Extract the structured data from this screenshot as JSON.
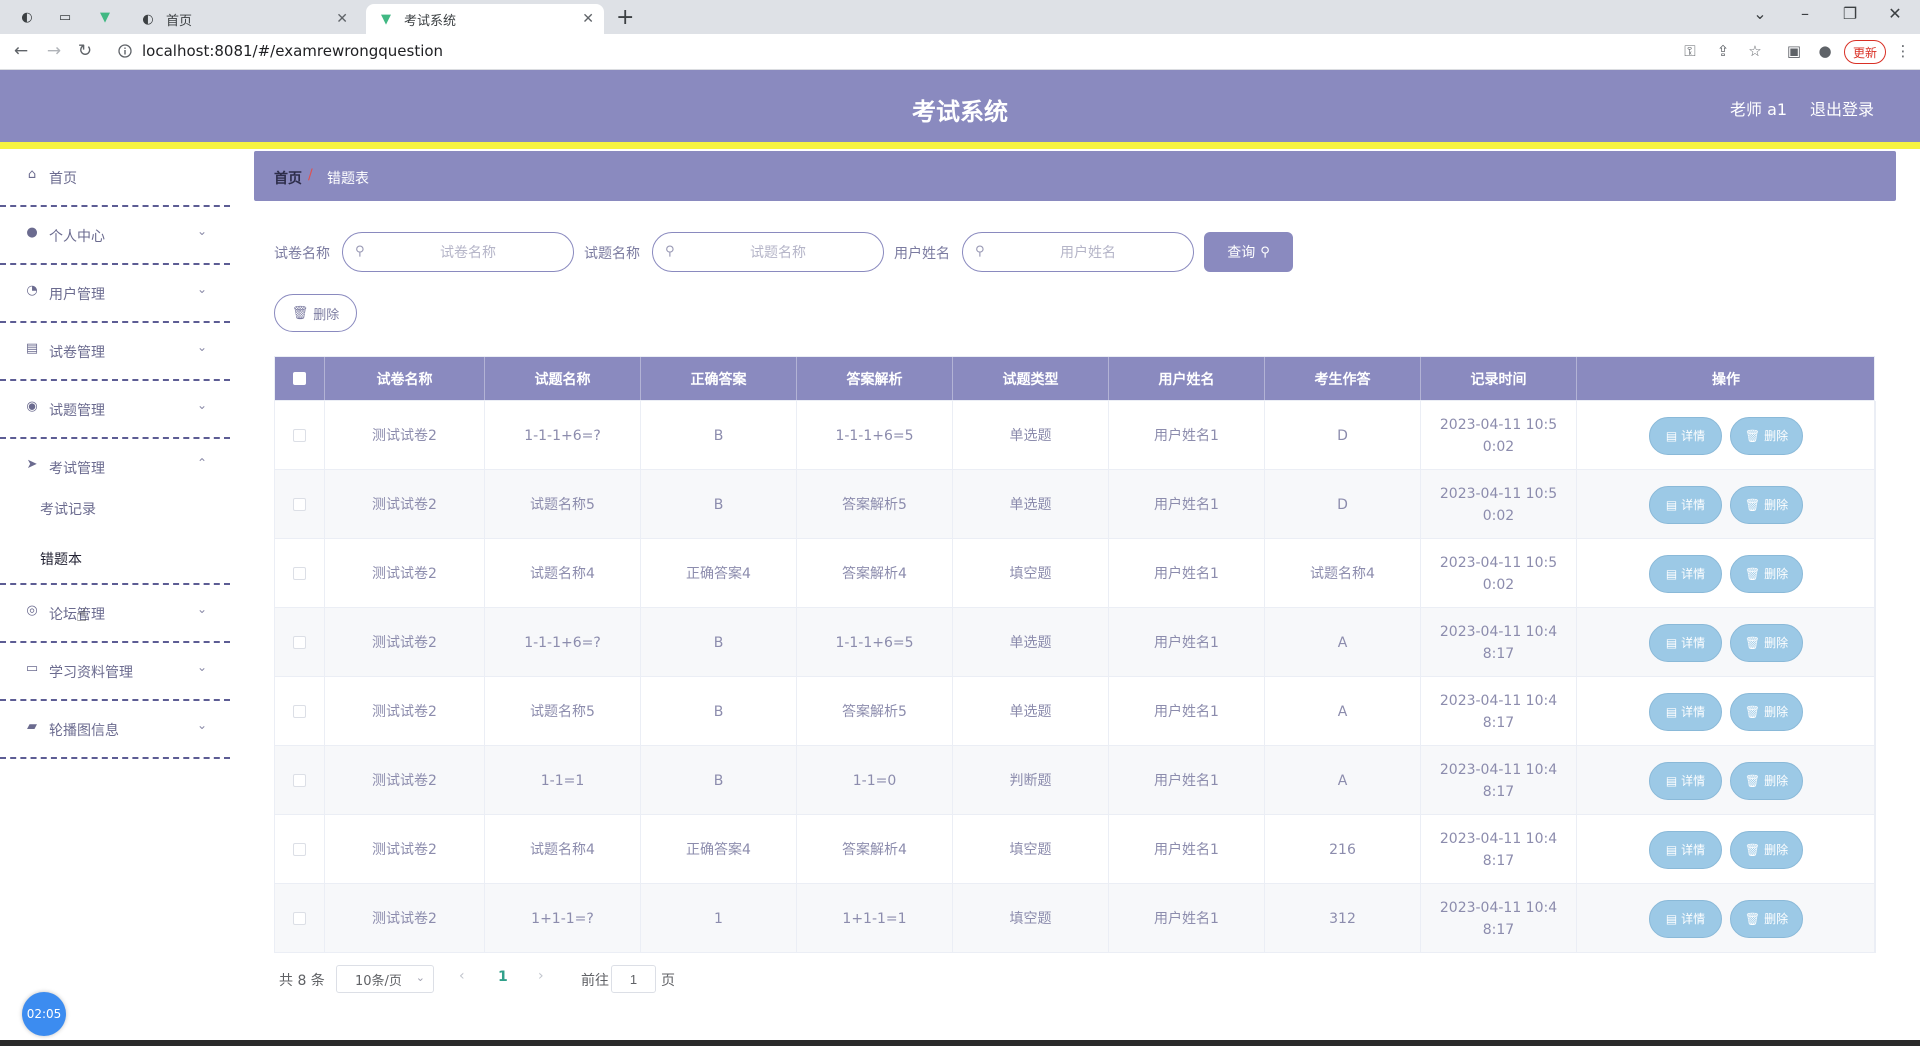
{
  "browser": {
    "tabs": [
      {
        "title": "首页",
        "active": false
      },
      {
        "title": "考试系统",
        "active": true
      }
    ],
    "url": "localhost:8081/#/examrewrongquestion",
    "update_label": "更新"
  },
  "header": {
    "title": "考试系统",
    "user": "老师 a1",
    "logout": "退出登录"
  },
  "sidebar": {
    "items": [
      {
        "label": "首页",
        "icon": "home-icon"
      },
      {
        "label": "个人中心",
        "icon": "user-icon"
      },
      {
        "label": "用户管理",
        "icon": "gauge-icon"
      },
      {
        "label": "试卷管理",
        "icon": "paper-icon"
      },
      {
        "label": "试题管理",
        "icon": "pin-icon"
      },
      {
        "label": "考试管理",
        "icon": "send-icon",
        "expanded": true
      },
      {
        "label": "论坛管理",
        "icon": "globe-icon"
      },
      {
        "label": "学习资料管理",
        "icon": "chat-icon"
      },
      {
        "label": "轮播图信息",
        "icon": "briefcase-icon"
      }
    ],
    "sub_items": [
      {
        "label": "考试记录",
        "active": false
      },
      {
        "label": "错题本",
        "active": true
      }
    ],
    "clock": "02:05"
  },
  "breadcrumb": {
    "home": "首页",
    "separator": "/",
    "current": "错题表"
  },
  "search": {
    "paper_label": "试卷名称",
    "paper_placeholder": "试卷名称",
    "question_label": "试题名称",
    "question_placeholder": "试题名称",
    "user_label": "用户姓名",
    "user_placeholder": "用户姓名",
    "query_button": "查询"
  },
  "actions": {
    "delete_button": "删除"
  },
  "table": {
    "columns": [
      "试卷名称",
      "试题名称",
      "正确答案",
      "答案解析",
      "试题类型",
      "用户姓名",
      "考生作答",
      "记录时间",
      "操作"
    ],
    "rows": [
      [
        "测试试卷2",
        "1-1-1+6=?",
        "B",
        "1-1-1+6=5",
        "单选题",
        "用户姓名1",
        "D",
        "2023-04-11 10:50:02"
      ],
      [
        "测试试卷2",
        "试题名称5",
        "B",
        "答案解析5",
        "单选题",
        "用户姓名1",
        "D",
        "2023-04-11 10:50:02"
      ],
      [
        "测试试卷2",
        "试题名称4",
        "正确答案4",
        "答案解析4",
        "填空题",
        "用户姓名1",
        "试题名称4",
        "2023-04-11 10:50:02"
      ],
      [
        "测试试卷2",
        "1-1-1+6=?",
        "B",
        "1-1-1+6=5",
        "单选题",
        "用户姓名1",
        "A",
        "2023-04-11 10:48:17"
      ],
      [
        "测试试卷2",
        "试题名称5",
        "B",
        "答案解析5",
        "单选题",
        "用户姓名1",
        "A",
        "2023-04-11 10:48:17"
      ],
      [
        "测试试卷2",
        "1-1=1",
        "B",
        "1-1=0",
        "判断题",
        "用户姓名1",
        "A",
        "2023-04-11 10:48:17"
      ],
      [
        "测试试卷2",
        "试题名称4",
        "正确答案4",
        "答案解析4",
        "填空题",
        "用户姓名1",
        "216",
        "2023-04-11 10:48:17"
      ],
      [
        "测试试卷2",
        "1+1-1=?",
        "1",
        "1+1-1=1",
        "填空题",
        "用户姓名1",
        "312",
        "2023-04-11 10:48:17"
      ]
    ],
    "detail_label": "详情",
    "delete_label": "删除"
  },
  "pagination": {
    "total": "共 8 条",
    "page_size": "10条/页",
    "current_page": "1",
    "goto_label": "前往",
    "goto_value": "1",
    "page_label": "页"
  },
  "colors": {
    "primary": "#8a8abf",
    "accent_strip": "#f7f341",
    "op_button": "#9cc9e6"
  }
}
